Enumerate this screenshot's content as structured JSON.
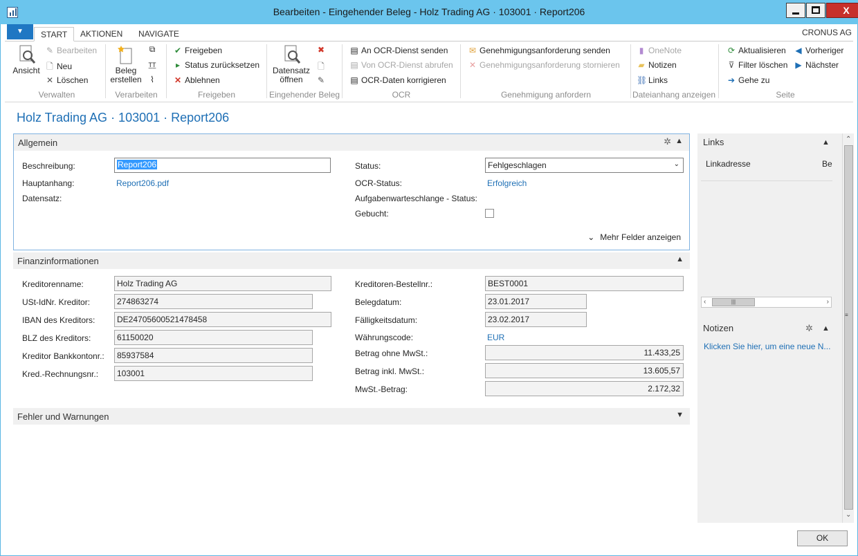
{
  "window": {
    "title": "Bearbeiten - Eingehender Beleg - Holz Trading AG · 103001 · Report206",
    "close_label": "X"
  },
  "ribbon_tabs": {
    "items": [
      "START",
      "AKTIONEN",
      "NAVIGATE"
    ],
    "active": "START",
    "company": "CRONUS AG"
  },
  "ribbon": {
    "groups": {
      "verwalten": "Verwalten",
      "verarbeiten": "Verarbeiten",
      "freigeben": "Freigeben",
      "eingehender_beleg": "Eingehender Beleg",
      "ocr": "OCR",
      "genehmigung": "Genehmigung anfordern",
      "dateianhang": "Dateianhang anzeigen",
      "seite": "Seite"
    },
    "actions": {
      "ansicht": "Ansicht",
      "bearbeiten": "Bearbeiten",
      "neu": "Neu",
      "loeschen": "Löschen",
      "beleg_erstellen_1": "Beleg",
      "beleg_erstellen_2": "erstellen",
      "freigeben": "Freigeben",
      "status_zuruecksetzen": "Status zurücksetzen",
      "ablehnen": "Ablehnen",
      "datensatz_oeffnen_1": "Datensatz",
      "datensatz_oeffnen_2": "öffnen",
      "an_ocr_senden": "An OCR-Dienst senden",
      "von_ocr_abrufen": "Von OCR-Dienst abrufen",
      "ocr_korrigieren": "OCR-Daten korrigieren",
      "genehmigung_senden": "Genehmigungsanforderung senden",
      "genehmigung_stornieren": "Genehmigungsanforderung stornieren",
      "onenote": "OneNote",
      "notizen": "Notizen",
      "links": "Links",
      "aktualisieren": "Aktualisieren",
      "filter_loeschen": "Filter löschen",
      "gehe_zu": "Gehe zu",
      "vorheriger": "Vorheriger",
      "naechster": "Nächster"
    }
  },
  "page_title": "Holz Trading AG · 103001 · Report206",
  "allgemein": {
    "header": "Allgemein",
    "beschreibung_label": "Beschreibung:",
    "beschreibung_value": "Report206",
    "hauptanhang_label": "Hauptanhang:",
    "hauptanhang_value": "Report206.pdf",
    "datensatz_label": "Datensatz:",
    "status_label": "Status:",
    "status_value": "Fehlgeschlagen",
    "ocr_status_label": "OCR-Status:",
    "ocr_status_value": "Erfolgreich",
    "aufgaben_label": "Aufgabenwarteschlange - Status:",
    "gebucht_label": "Gebucht:",
    "gebucht_checked": false,
    "more_fields": "Mehr Felder anzeigen"
  },
  "finanz": {
    "header": "Finanzinformationen",
    "kreditorenname_label": "Kreditorenname:",
    "kreditorenname_value": "Holz Trading AG",
    "ustid_label": "USt-IdNr. Kreditor:",
    "ustid_value": "274863274",
    "iban_label": "IBAN des Kreditors:",
    "iban_value": "DE24705600521478458",
    "blz_label": "BLZ des Kreditors:",
    "blz_value": "61150020",
    "konto_label": "Kreditor Bankkontonr.:",
    "konto_value": "85937584",
    "rechnung_label": "Kred.-Rechnungsnr.:",
    "rechnung_value": "103001",
    "bestellnr_label": "Kreditoren-Bestellnr.:",
    "bestellnr_value": "BEST0001",
    "belegdatum_label": "Belegdatum:",
    "belegdatum_value": "23.01.2017",
    "faelligkeit_label": "Fälligkeitsdatum:",
    "faelligkeit_value": "23.02.2017",
    "waehrung_label": "Währungscode:",
    "waehrung_value": "EUR",
    "ohne_mwst_label": "Betrag ohne MwSt.:",
    "ohne_mwst_value": "11.433,25",
    "inkl_mwst_label": "Betrag inkl. MwSt.:",
    "inkl_mwst_value": "13.605,57",
    "mwst_label": "MwSt.-Betrag:",
    "mwst_value": "2.172,32"
  },
  "fehler": {
    "header": "Fehler und Warnungen"
  },
  "factbox": {
    "links_header": "Links",
    "linkadresse": "Linkadresse",
    "links_col2": "Be",
    "notizen_header": "Notizen",
    "notizen_link": "Klicken Sie hier, um eine neue N..."
  },
  "footer": {
    "ok": "OK"
  },
  "colors": {
    "titlebar": "#6bc5ed",
    "accent": "#1e6fb5",
    "app_menu": "#1f77c3",
    "close": "#c7302b"
  }
}
